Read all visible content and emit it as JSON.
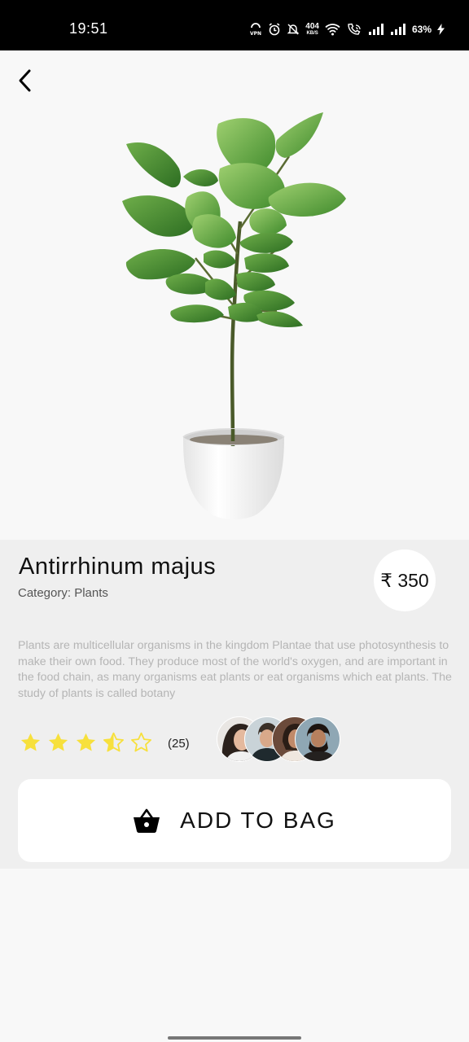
{
  "status_bar": {
    "time": "19:51",
    "speed_value": "404",
    "speed_unit": "KB/S",
    "battery": "63%",
    "icons": [
      "vpn-icon",
      "alarm-icon",
      "mute-icon",
      "wifi-icon",
      "wifi-call-icon",
      "signal-icon",
      "signal-icon",
      "charging-icon"
    ]
  },
  "header": {
    "back_icon": "chevron-left-icon"
  },
  "product": {
    "name": "Antirrhinum majus",
    "category": "Category: Plants",
    "price": "₹ 350",
    "description": "Plants are multicellular organisms in the kingdom Plantae that use photosynthesis to make their own food. They produce most of the world's oxygen, and are important in the food chain, as many organisms eat plants or eat organisms which eat plants. The study of plants is called botany",
    "image": "potted-fiddle-leaf-fig"
  },
  "rating": {
    "value": 3.5,
    "max": 5,
    "count_label": "(25)",
    "star_color": "#f7e03c",
    "reviewer_avatars": 4
  },
  "cta": {
    "label": "ADD TO BAG",
    "icon": "shopping-basket-icon"
  }
}
